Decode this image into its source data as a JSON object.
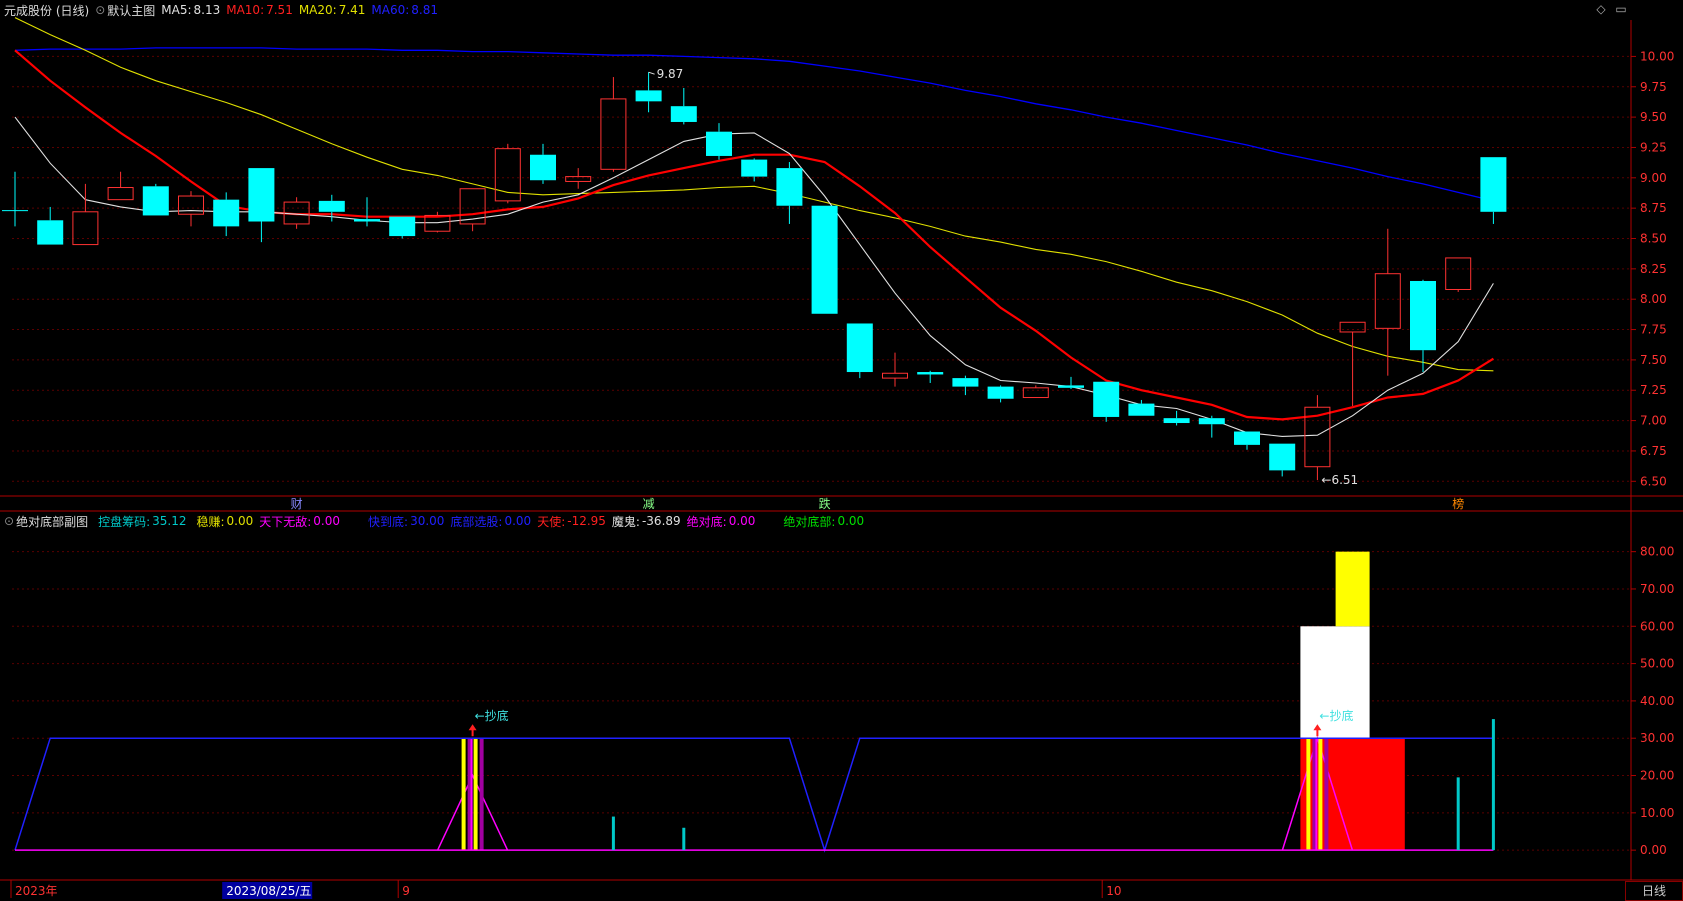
{
  "colors": {
    "bg": "#000000",
    "axis": "#b00000",
    "grid": "#5a0000",
    "up": "#ff3232",
    "down": "#00ffff",
    "ma5": "#e0e0e0",
    "ma10": "#ff0000",
    "ma20": "#e0e000",
    "ma60": "#0000ff",
    "axis_text": "#ff3232"
  },
  "main_header": {
    "stock": "元成股份 (日线)",
    "template": "默认主图",
    "ma5_label": "MA5:",
    "ma5_value": "8.13",
    "ma10_label": "MA10:",
    "ma10_value": "7.51",
    "ma20_label": "MA20:",
    "ma20_value": "7.41",
    "ma60_label": "MA60:",
    "ma60_value": "8.81"
  },
  "sub_header": {
    "title": "绝对底部副图",
    "kpcm_label": "控盘筹码:",
    "kpcm_value": "35.12",
    "wz_label": "稳赚:",
    "wz_value": "0.00",
    "txwd_label": "天下无敌:",
    "txwd_value": "0.00",
    "kdd_label": "快到底:",
    "kdd_value": "30.00",
    "dbxg_label": "底部选股:",
    "dbxg_value": "0.00",
    "ts_label": "天使:",
    "ts_value": "-12.95",
    "mg_label": "魔鬼:",
    "mg_value": "-36.89",
    "jdd_label": "绝对底:",
    "jdd_value": "0.00",
    "jddb_label": "绝对底部:",
    "jddb_value": "0.00"
  },
  "chart_data": [
    {
      "type": "candlestick",
      "name": "main",
      "ylim": [
        6.42,
        10.3
      ],
      "y_ticks": [
        "10.00",
        "9.75",
        "9.50",
        "9.25",
        "9.00",
        "8.75",
        "8.50",
        "8.25",
        "8.00",
        "7.75",
        "7.50",
        "7.25",
        "7.00",
        "6.75",
        "6.50"
      ],
      "candles": [
        {
          "o": 8.73,
          "c": 8.73,
          "h": 9.05,
          "l": 8.6
        },
        {
          "o": 8.65,
          "c": 8.45,
          "h": 8.76,
          "l": 8.45
        },
        {
          "o": 8.45,
          "c": 8.72,
          "h": 8.95,
          "l": 8.45
        },
        {
          "o": 8.82,
          "c": 8.92,
          "h": 9.05,
          "l": 8.82
        },
        {
          "o": 8.93,
          "c": 8.69,
          "h": 8.95,
          "l": 8.69
        },
        {
          "o": 8.7,
          "c": 8.85,
          "h": 8.89,
          "l": 8.6
        },
        {
          "o": 8.82,
          "c": 8.6,
          "h": 8.88,
          "l": 8.52
        },
        {
          "o": 9.08,
          "c": 8.64,
          "h": 9.08,
          "l": 8.47
        },
        {
          "o": 8.62,
          "c": 8.8,
          "h": 8.84,
          "l": 8.58
        },
        {
          "o": 8.81,
          "c": 8.72,
          "h": 8.86,
          "l": 8.64
        },
        {
          "o": 8.66,
          "c": 8.64,
          "h": 8.84,
          "l": 8.6
        },
        {
          "o": 8.68,
          "c": 8.52,
          "h": 8.68,
          "l": 8.5
        },
        {
          "o": 8.56,
          "c": 8.69,
          "h": 8.72,
          "l": 8.55
        },
        {
          "o": 8.62,
          "c": 8.91,
          "h": 8.91,
          "l": 8.56
        },
        {
          "o": 8.81,
          "c": 9.24,
          "h": 9.28,
          "l": 8.79
        },
        {
          "o": 9.19,
          "c": 8.98,
          "h": 9.28,
          "l": 8.95
        },
        {
          "o": 8.97,
          "c": 9.01,
          "h": 9.08,
          "l": 8.91
        },
        {
          "o": 9.07,
          "c": 9.65,
          "h": 9.83,
          "l": 9.05
        },
        {
          "o": 9.72,
          "c": 9.63,
          "h": 9.87,
          "l": 9.54
        },
        {
          "o": 9.59,
          "c": 9.46,
          "h": 9.74,
          "l": 9.44
        },
        {
          "o": 9.38,
          "c": 9.18,
          "h": 9.45,
          "l": 9.15
        },
        {
          "o": 9.15,
          "c": 9.01,
          "h": 9.16,
          "l": 8.97
        },
        {
          "o": 9.08,
          "c": 8.77,
          "h": 9.13,
          "l": 8.62
        },
        {
          "o": 8.77,
          "c": 7.88,
          "h": 8.77,
          "l": 7.88
        },
        {
          "o": 7.8,
          "c": 7.4,
          "h": 7.8,
          "l": 7.35
        },
        {
          "o": 7.35,
          "c": 7.39,
          "h": 7.56,
          "l": 7.28
        },
        {
          "o": 7.4,
          "c": 7.38,
          "h": 7.41,
          "l": 7.31
        },
        {
          "o": 7.35,
          "c": 7.28,
          "h": 7.37,
          "l": 7.21
        },
        {
          "o": 7.28,
          "c": 7.18,
          "h": 7.29,
          "l": 7.15
        },
        {
          "o": 7.19,
          "c": 7.27,
          "h": 7.29,
          "l": 7.19
        },
        {
          "o": 7.29,
          "c": 7.27,
          "h": 7.36,
          "l": 7.26
        },
        {
          "o": 7.32,
          "c": 7.03,
          "h": 7.32,
          "l": 6.99
        },
        {
          "o": 7.14,
          "c": 7.04,
          "h": 7.17,
          "l": 7.04
        },
        {
          "o": 7.02,
          "c": 6.98,
          "h": 7.08,
          "l": 6.96
        },
        {
          "o": 7.02,
          "c": 6.97,
          "h": 7.04,
          "l": 6.86
        },
        {
          "o": 6.91,
          "c": 6.8,
          "h": 6.91,
          "l": 6.76
        },
        {
          "o": 6.81,
          "c": 6.59,
          "h": 6.81,
          "l": 6.54
        },
        {
          "o": 6.62,
          "c": 7.11,
          "h": 7.21,
          "l": 6.51
        },
        {
          "o": 7.73,
          "c": 7.81,
          "h": 7.81,
          "l": 7.12
        },
        {
          "o": 7.76,
          "c": 8.21,
          "h": 8.58,
          "l": 7.37
        },
        {
          "o": 8.15,
          "c": 7.58,
          "h": 8.16,
          "l": 7.4
        },
        {
          "o": 8.08,
          "c": 8.34,
          "h": 8.34,
          "l": 8.06
        },
        {
          "o": 9.17,
          "c": 8.72,
          "h": 9.17,
          "l": 8.62
        }
      ],
      "ma5": [
        9.5,
        9.12,
        8.82,
        8.76,
        8.72,
        8.73,
        8.72,
        8.72,
        8.7,
        8.68,
        8.65,
        8.63,
        8.63,
        8.66,
        8.7,
        8.8,
        8.86,
        9.0,
        9.15,
        9.3,
        9.36,
        9.37,
        9.2,
        8.85,
        8.45,
        8.05,
        7.7,
        7.46,
        7.33,
        7.31,
        7.28,
        7.21,
        7.13,
        7.1,
        7.01,
        6.9,
        6.87,
        6.88,
        7.04,
        7.25,
        7.39,
        7.65,
        8.13
      ],
      "ma10": [
        10.05,
        9.8,
        9.58,
        9.37,
        9.18,
        8.97,
        8.77,
        8.72,
        8.7,
        8.7,
        8.68,
        8.68,
        8.68,
        8.7,
        8.74,
        8.76,
        8.83,
        8.94,
        9.02,
        9.08,
        9.14,
        9.19,
        9.19,
        9.13,
        8.93,
        8.71,
        8.43,
        8.18,
        7.93,
        7.74,
        7.52,
        7.33,
        7.25,
        7.19,
        7.13,
        7.03,
        7.01,
        7.04,
        7.11,
        7.19,
        7.22,
        7.33,
        7.51
      ],
      "ma20": [
        10.32,
        10.18,
        10.05,
        9.91,
        9.8,
        9.71,
        9.62,
        9.52,
        9.4,
        9.28,
        9.17,
        9.07,
        9.02,
        8.95,
        8.88,
        8.86,
        8.87,
        8.88,
        8.89,
        8.9,
        8.92,
        8.93,
        8.87,
        8.8,
        8.73,
        8.67,
        8.6,
        8.52,
        8.47,
        8.41,
        8.37,
        8.31,
        8.23,
        8.14,
        8.07,
        7.98,
        7.87,
        7.72,
        7.61,
        7.53,
        7.48,
        7.42,
        7.41
      ],
      "ma60": [
        10.05,
        10.06,
        10.06,
        10.06,
        10.07,
        10.07,
        10.07,
        10.07,
        10.06,
        10.06,
        10.06,
        10.05,
        10.05,
        10.04,
        10.04,
        10.03,
        10.02,
        10.01,
        10.01,
        10.0,
        9.99,
        9.98,
        9.96,
        9.92,
        9.88,
        9.83,
        9.78,
        9.72,
        9.67,
        9.61,
        9.56,
        9.5,
        9.45,
        9.39,
        9.33,
        9.27,
        9.2,
        9.14,
        9.08,
        9.01,
        8.95,
        8.88,
        8.81
      ],
      "annotations": [
        {
          "text": "9.87",
          "index": 18,
          "value": 9.87
        },
        {
          "text": "←6.51",
          "index": 37,
          "value": 6.51
        }
      ],
      "event_markers": [
        {
          "text": "财",
          "index": 8
        },
        {
          "text": "减",
          "index": 18
        },
        {
          "text": "跌",
          "index": 23
        },
        {
          "text": "榜",
          "index": 41
        }
      ]
    },
    {
      "type": "indicator",
      "name": "sub",
      "ylim": [
        -8,
        85
      ],
      "y_ticks": [
        "80.00",
        "70.00",
        "60.00",
        "50.00",
        "40.00",
        "30.00",
        "20.00",
        "10.00",
        "0.00"
      ],
      "kdd": [
        0,
        30,
        30,
        30,
        30,
        30,
        30,
        30,
        30,
        30,
        30,
        30,
        30,
        30,
        30,
        30,
        30,
        30,
        30,
        30,
        30,
        30,
        30,
        0,
        30,
        30,
        30,
        30,
        30,
        30,
        30,
        30,
        30,
        30,
        30,
        30,
        30,
        30,
        30,
        30,
        30,
        30,
        30
      ],
      "kpcm": [
        0,
        0,
        0,
        0,
        0,
        0,
        0,
        0,
        0,
        0,
        0,
        0,
        0,
        0,
        0,
        0,
        0,
        9,
        0,
        6,
        0,
        0,
        0,
        0,
        0,
        0,
        0,
        0,
        0,
        0,
        0,
        0,
        0,
        0,
        0,
        0,
        0,
        0,
        0,
        0,
        0,
        19.5,
        35.12
      ],
      "tianshi_peaks": [
        {
          "index": 13,
          "value": 20
        },
        {
          "index": 37,
          "value": 30
        }
      ],
      "chaodi": [
        {
          "text": "←抄底",
          "index": 13
        },
        {
          "text": "←抄底",
          "index": 37
        }
      ],
      "red_block": {
        "from": 37,
        "to": 39,
        "value": 30
      },
      "white_block": {
        "from": 37,
        "to": 38,
        "value": 60
      },
      "yellow_block": {
        "index": 38,
        "value": 80
      }
    }
  ],
  "x_labels": [
    {
      "text": "2023年",
      "index": 0,
      "color": "#ff3232"
    },
    {
      "text": "2023/08/25/五",
      "index": 6,
      "color": "#ffffff",
      "highlight": true
    },
    {
      "text": "9",
      "index": 11,
      "color": "#ff3232"
    },
    {
      "text": "10",
      "index": 31,
      "color": "#ff3232"
    }
  ],
  "bottom_tab": "日线"
}
